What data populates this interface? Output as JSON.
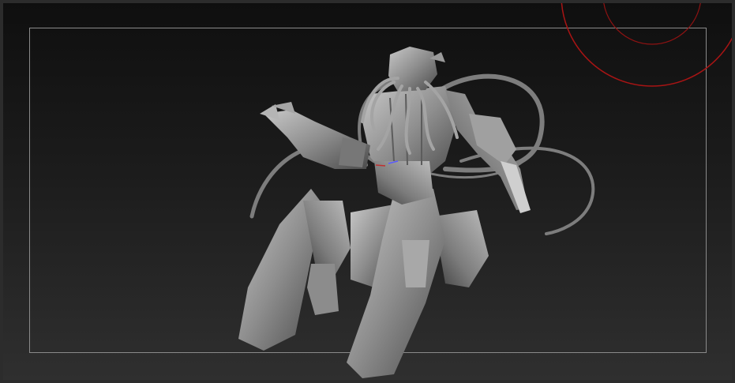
{
  "viewport": {
    "background_top": "#0f0f0f",
    "background_bottom": "#2f2f2f",
    "frame_color": "#8a8a8a",
    "gizmo_color": "#b01515",
    "sculpt_color": "#9a9a9a"
  },
  "scene": {
    "model_icon": "tentacle-creature-sculpt",
    "gizmo_icon": "rotation-circle-gizmo"
  }
}
